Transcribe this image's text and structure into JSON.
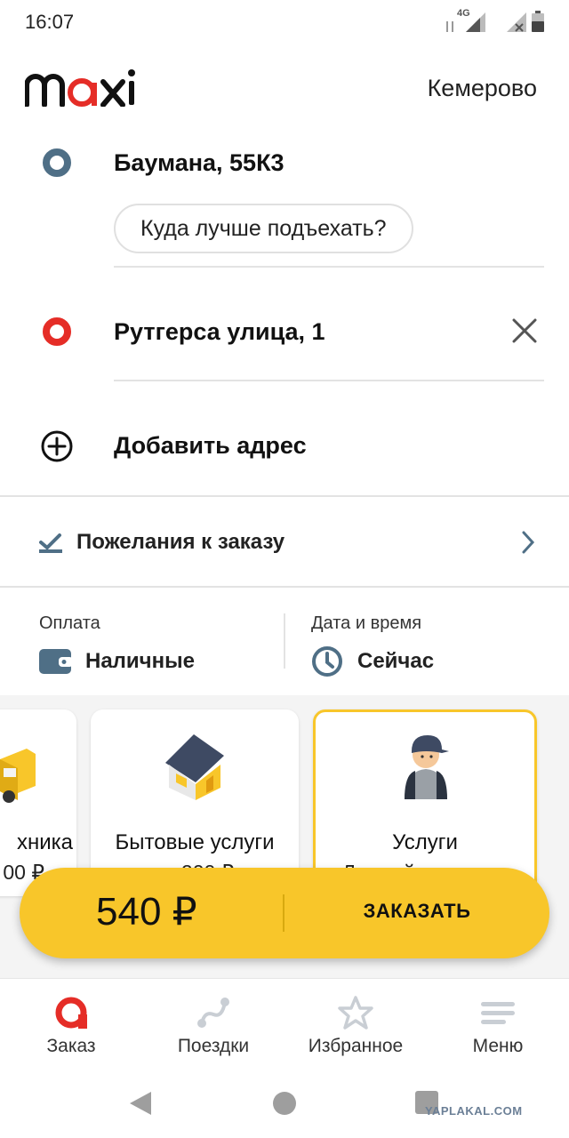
{
  "status_bar": {
    "time": "16:07",
    "network": "4G"
  },
  "header": {
    "logo_text": "maxim",
    "city": "Кемерово"
  },
  "route": {
    "from": "Баумана, 55К3",
    "pickup_hint": "Куда лучше подъехать?",
    "to": "Рутгерса улица, 1",
    "add_address": "Добавить адрес"
  },
  "wishes": {
    "label": "Пожелания к заказу"
  },
  "payment": {
    "label": "Оплата",
    "value": "Наличные",
    "datetime_label": "Дата и время",
    "datetime_value": "Сейчас"
  },
  "services": [
    {
      "title": "хника",
      "subtitle": "00 ₽"
    },
    {
      "title": "Бытовые услуги",
      "subtitle": "от 200 ₽"
    },
    {
      "title": "Услуги",
      "subtitle": "Личный водитель"
    }
  ],
  "order": {
    "price": "540 ₽",
    "button_label": "ЗАКАЗАТЬ"
  },
  "bottom_nav": [
    {
      "label": "Заказ",
      "icon": "order-icon"
    },
    {
      "label": "Поездки",
      "icon": "trips-icon"
    },
    {
      "label": "Избранное",
      "icon": "star-icon"
    },
    {
      "label": "Меню",
      "icon": "menu-icon"
    }
  ],
  "watermark": "YAPLAKAL.COM",
  "colors": {
    "accent_yellow": "#f8c62a",
    "brand_red": "#e52d27",
    "slate": "#4f6f86"
  }
}
